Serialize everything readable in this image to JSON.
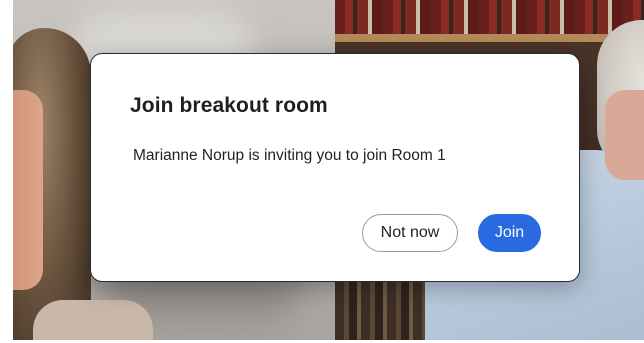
{
  "dialog": {
    "title": "Join breakout room",
    "message": "Marianne Norup is inviting you to join Room 1",
    "buttons": {
      "secondary_label": "Not now",
      "primary_label": "Join"
    }
  },
  "colors": {
    "primary_button": "#2a6ae0",
    "dialog_background": "#ffffff",
    "title_text": "#1f1f1f"
  }
}
